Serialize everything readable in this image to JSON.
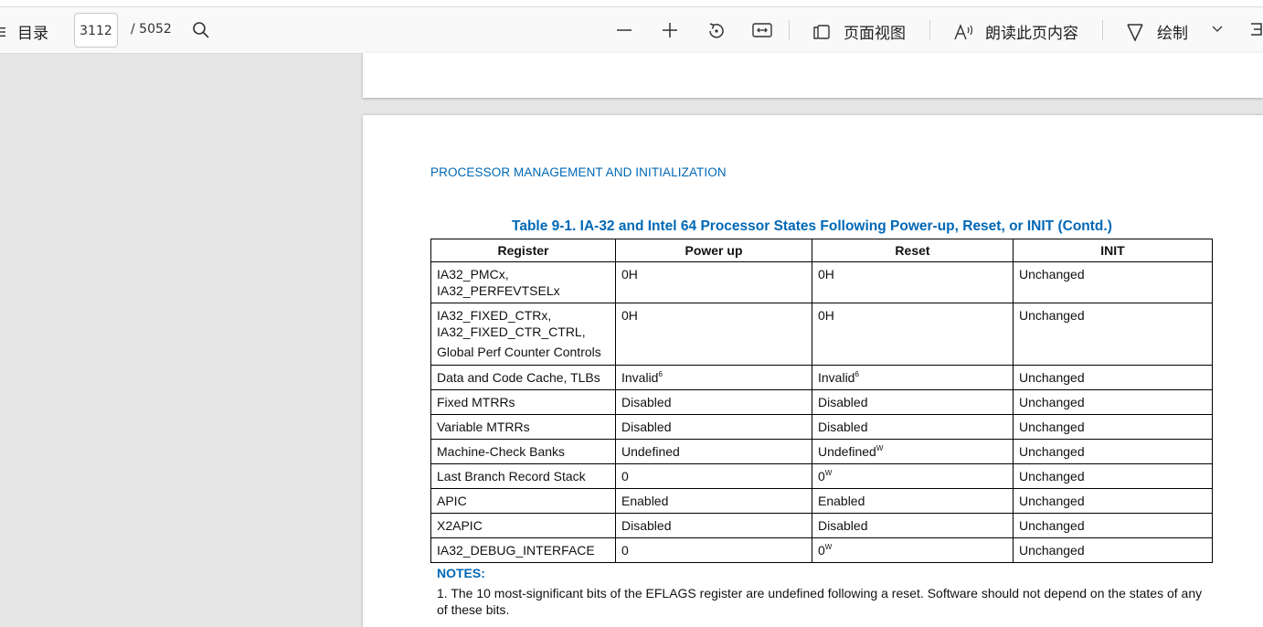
{
  "toolbar": {
    "toc_label": "目录",
    "page_current": "3112",
    "page_total": "/ 5052",
    "page_view_label": "页面视图",
    "read_aloud_label": "朗读此页内容",
    "draw_label": "绘制"
  },
  "document": {
    "section_header": "PROCESSOR MANAGEMENT AND INITIALIZATION",
    "table_caption": "Table 9-1.  IA-32 and Intel 64 Processor States Following Power-up, Reset, or INIT  (Contd.)",
    "columns": [
      "Register",
      "Power up",
      "Reset",
      "INIT"
    ],
    "rows": [
      {
        "register": [
          "IA32_PMCx,",
          "IA32_PERFEVTSELx"
        ],
        "power_up": "0H",
        "reset": "0H",
        "init": "Unchanged"
      },
      {
        "register": [
          "IA32_FIXED_CTRx,",
          "IA32_FIXED_CTR_CTRL,",
          "Global Perf Counter Controls"
        ],
        "power_up": "0H",
        "reset": "0H",
        "init": "Unchanged"
      },
      {
        "register": [
          "Data and Code Cache, TLBs"
        ],
        "power_up": "Invalid",
        "power_up_sup": "6",
        "reset": "Invalid",
        "reset_sup": "6",
        "init": "Unchanged"
      },
      {
        "register": [
          "Fixed MTRRs"
        ],
        "power_up": "Disabled",
        "reset": "Disabled",
        "init": "Unchanged"
      },
      {
        "register": [
          "Variable MTRRs"
        ],
        "power_up": "Disabled",
        "reset": "Disabled",
        "init": "Unchanged"
      },
      {
        "register": [
          "Machine-Check Banks"
        ],
        "power_up": "Undefined",
        "reset": "Undefined",
        "reset_sup": "W",
        "init": "Unchanged"
      },
      {
        "register": [
          "Last Branch Record Stack"
        ],
        "power_up": "0",
        "reset": "0",
        "reset_sup": "W",
        "init": "Unchanged"
      },
      {
        "register": [
          "APIC"
        ],
        "power_up": "Enabled",
        "reset": "Enabled",
        "init": "Unchanged"
      },
      {
        "register": [
          "X2APIC"
        ],
        "power_up": "Disabled",
        "reset": "Disabled",
        "init": "Unchanged"
      },
      {
        "register": [
          "IA32_DEBUG_INTERFACE"
        ],
        "power_up": "0",
        "reset": "0",
        "reset_sup": "W",
        "init": "Unchanged"
      }
    ],
    "notes_title": "NOTES:",
    "note_1": "1. The 10 most-significant bits of the EFLAGS register are undefined following a reset. Software should not depend on the states of any of these bits."
  },
  "colors": {
    "accent_blue": "#0068b5",
    "toolbar_bg": "#f9f9f9",
    "canvas_bg": "#e6e6e6"
  }
}
